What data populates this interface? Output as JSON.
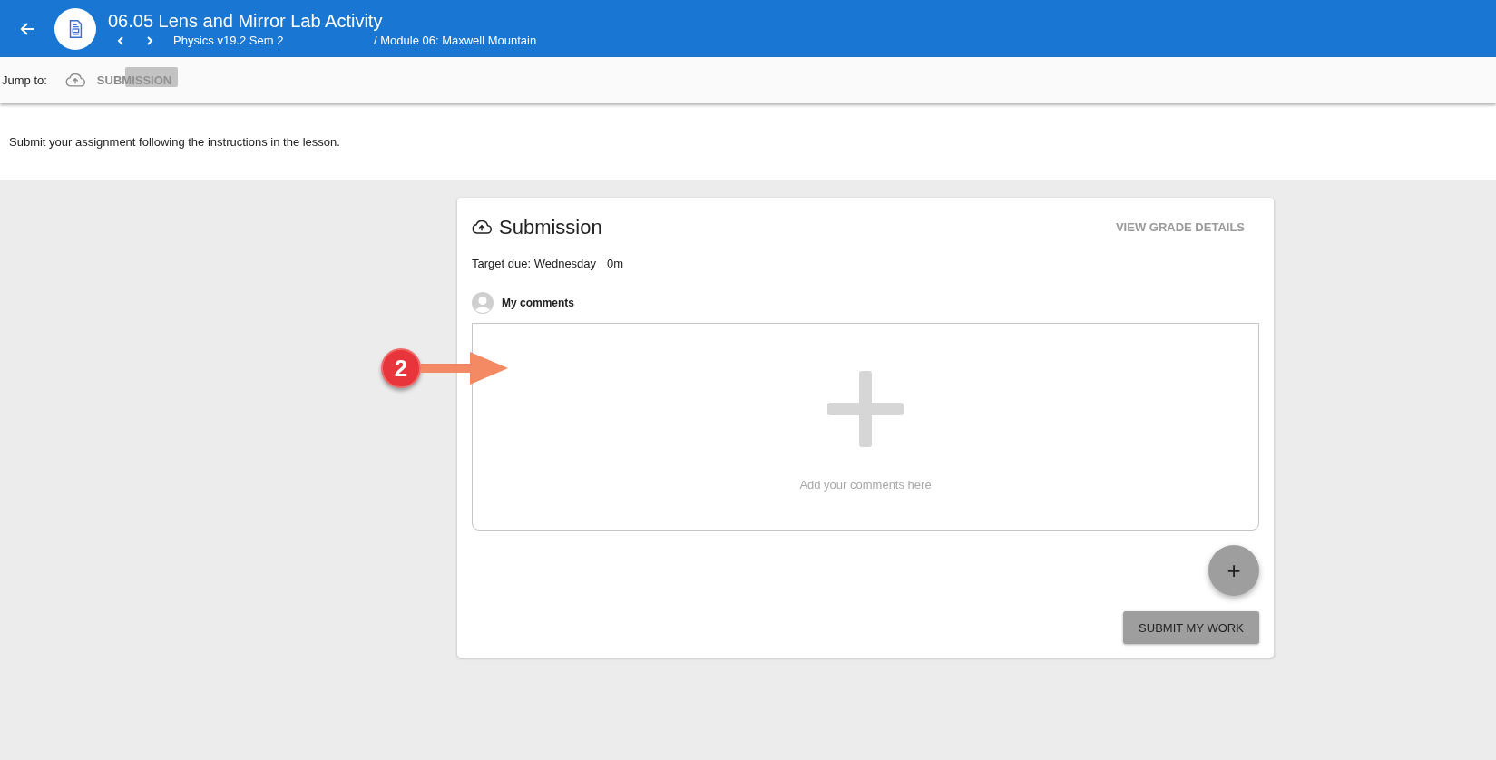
{
  "header": {
    "title": "06.05 Lens and Mirror Lab Activity",
    "course": "Physics v19.2 Sem 2",
    "module": "/ Module 06: Maxwell Mountain"
  },
  "jump_bar": {
    "label": "Jump to:",
    "link": "SUBMISSION"
  },
  "instructions": "Submit your assignment following the instructions in the lesson.",
  "card": {
    "title": "Submission",
    "grade_link": "VIEW GRADE DETAILS",
    "due_label": "Target due: Wednesday",
    "due_time": "0m",
    "comments_label": "My comments",
    "comment_hint": "Add your comments here",
    "fab": "+",
    "submit": "SUBMIT MY WORK"
  },
  "annotation": {
    "number": "2"
  }
}
